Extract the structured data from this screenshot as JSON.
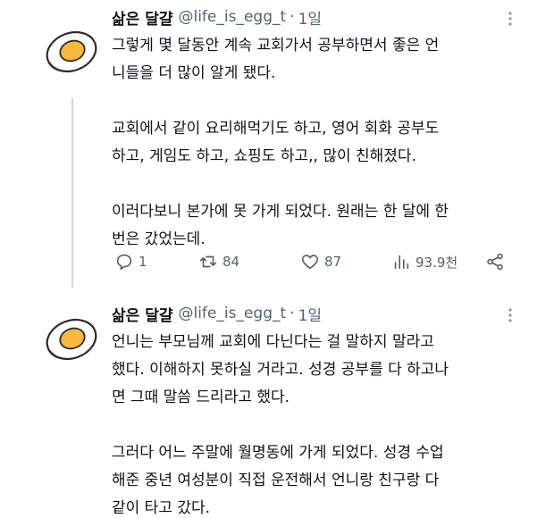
{
  "tweets": [
    {
      "author": {
        "name": "삶은 달걀",
        "handle": "@life_is_egg_t",
        "time": "1일"
      },
      "lines": [
        "그렇게 몇 달동안 계속 교회가서 공부하면서 좋은 언",
        "니들을 더 많이 알게 됐다.",
        "",
        "교회에서 같이 요리해먹기도 하고, 영어 회화 공부도",
        "하고, 게임도 하고, 쇼핑도 하고,, 많이 친해졌다.",
        "",
        "이러다보니 본가에 못 가게 되었다. 원래는 한 달에 한",
        "번은 갔었는데."
      ],
      "stats": {
        "replies": "1",
        "retweets": "84",
        "likes": "87",
        "views": "93.9천"
      }
    },
    {
      "author": {
        "name": "삶은 달걀",
        "handle": "@life_is_egg_t",
        "time": "1일"
      },
      "lines": [
        "언니는 부모님께 교회에 다닌다는 걸 말하지 말라고",
        "했다. 이해하지 못하실 거라고. 성경 공부를 다 하고나",
        "면 그때 말씀 드리라고 했다.",
        "",
        "그러다 어느 주말에 월명동에 가게 되었다. 성경 수업",
        "해준 중년 여성분이 직접 운전해서 언니랑 친구랑 다",
        "같이 타고 갔다."
      ]
    }
  ],
  "icons": {
    "avatar": "boiled-egg-icon",
    "more": "more-vertical-icon",
    "reply": "reply-icon",
    "retweet": "retweet-icon",
    "like": "heart-icon",
    "views": "views-chart-icon",
    "share": "share-icon"
  },
  "colors": {
    "text": "#0f1419",
    "secondary": "#536471",
    "thread_line": "#cfd9de",
    "yolk": "#f6b93b"
  }
}
